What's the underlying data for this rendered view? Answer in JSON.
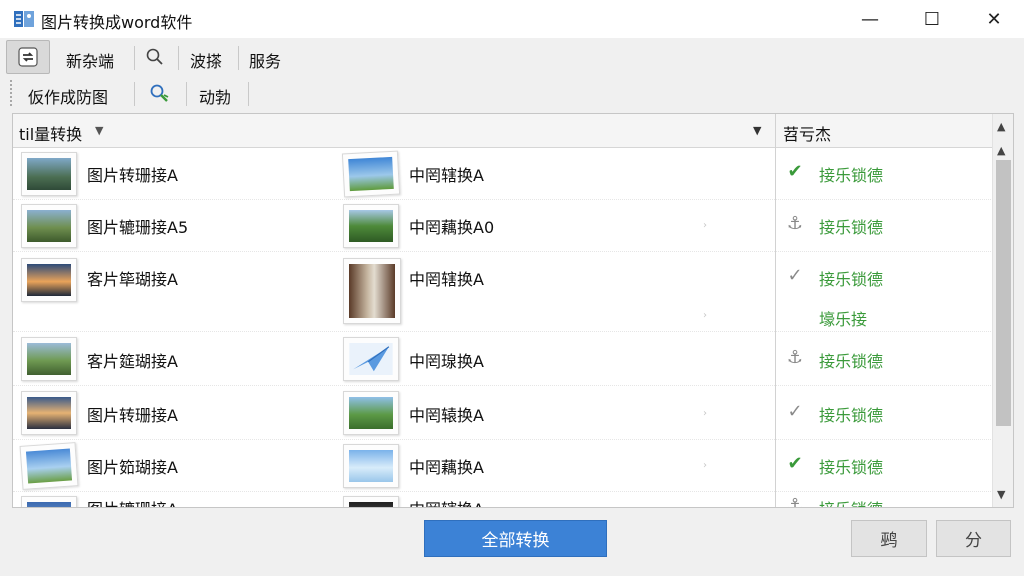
{
  "window": {
    "title": "图片转换成word软件",
    "minimize": "—",
    "maximize": "☐",
    "close": "✕"
  },
  "toolbar": {
    "row1": [
      "新杂端",
      "波搽",
      "服务"
    ],
    "row2": [
      "仮作成防图",
      "动勃"
    ],
    "collapse": "⌅"
  },
  "list": {
    "header_left": "til量转换",
    "header_status": "苕亏杰",
    "rows": [
      {
        "name1": "图片转珊接A",
        "name2": "中罔辖换A",
        "status_icon": "✔",
        "status_color": "#3a9a3a",
        "status": [
          "接乐锁德"
        ]
      },
      {
        "name1": "图片辘珊接A5",
        "name2": "中罔藕换A0",
        "status_icon": "⚓",
        "status_color": "#888888",
        "status": [
          "接乐锁德"
        ]
      },
      {
        "name1": "客片筚瑚接A",
        "name2": "中罔辖换A",
        "status_icon": "✓",
        "status_color": "#8a8a8a",
        "status": [
          "接乐锁德",
          "壕乐接"
        ]
      },
      {
        "name1": "客片筵瑚接A",
        "name2": "中罔瑔换A",
        "status_icon": "⚓",
        "status_color": "#888888",
        "status": [
          "接乐锁德"
        ]
      },
      {
        "name1": "图片转珊接A",
        "name2": "中罔辕换A",
        "status_icon": "✓",
        "status_color": "#8a8a8a",
        "status": [
          "接乐锁德"
        ]
      },
      {
        "name1": "图片筎瑚接A",
        "name2": "中罔藕换A",
        "status_icon": "✔",
        "status_color": "#3a9a3a",
        "status": [
          "接乐锁德"
        ]
      },
      {
        "name1": "图片辘珊接A",
        "name2": "中罔辖换A",
        "status_icon": "⚓",
        "status_color": "#888888",
        "status": [
          "接乐锁德"
        ]
      }
    ]
  },
  "buttons": {
    "convert_all": "全部转换",
    "secondary_a": "鹀",
    "secondary_b": "分"
  },
  "colors": {
    "accent": "#3c82d6",
    "status_green": "#3a9a3a"
  }
}
